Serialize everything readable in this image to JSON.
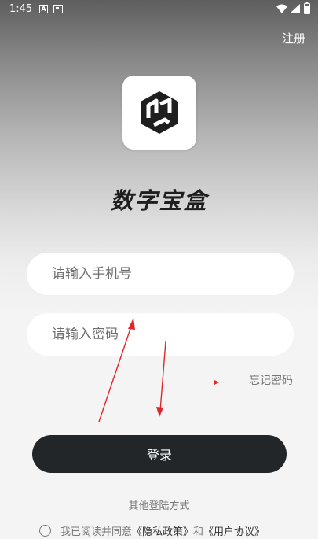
{
  "status_bar": {
    "time": "1:45",
    "icons": [
      "a-notification-icon",
      "card-notification-icon",
      "wifi-icon",
      "signal-icon",
      "battery-icon"
    ]
  },
  "header": {
    "register_label": "注册"
  },
  "app": {
    "logo_icon": "cube-logo-icon",
    "name": "数字宝盒"
  },
  "form": {
    "phone_placeholder": "请输入手机号",
    "password_placeholder": "请输入密码",
    "forgot_password_label": "忘记密码",
    "login_label": "登录"
  },
  "footer": {
    "other_login_label": "其他登陆方式",
    "agreement_prefix": "我已阅读并同意",
    "privacy_policy": "《隐私政策》",
    "and_word": "和",
    "user_agreement": "《用户协议》"
  },
  "colors": {
    "annotation_arrow": "#e0262a",
    "login_button": "#232629",
    "header_gradient_top": "#5e5e5e"
  }
}
